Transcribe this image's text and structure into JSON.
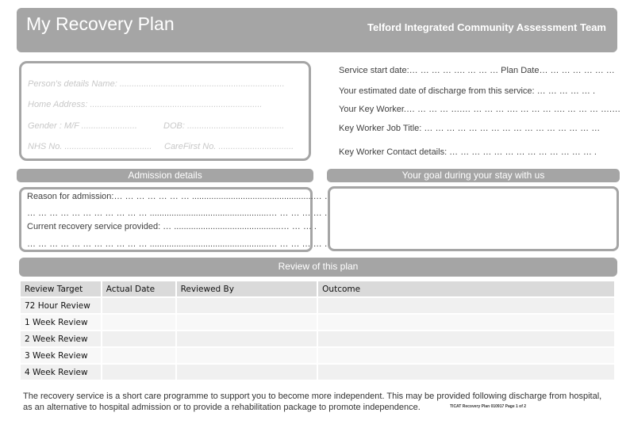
{
  "header": {
    "title": "My Recovery Plan",
    "organisation": "Telford Integrated Community Assessment Team"
  },
  "person_details": {
    "name_line": "Person's details   Name: ....................................................................",
    "address_line": "Home Address: .......................................................................",
    "gender_line": "Gender : M/F .......................",
    "dob_line": "DOB: ........................................",
    "nhs_line": "NHS No. ....................................",
    "carefirst_line": "CareFirst No. ..............................."
  },
  "service_info": {
    "start_date": "Service start date:… … … … …. … … …  Plan Date… … … … … … …",
    "discharge": "Your estimated date of discharge from this service: … … … … … .",
    "key_worker": "Your Key Worker.… … … … ….… … … … …. … … … …. … … … ….…",
    "job_title": "Key Worker Job Title: … … … … … … … … … … … … … … … …",
    "contact": "Key Worker Contact details: … … … … … … … … … … … … … ."
  },
  "admission": {
    "heading": "Admission details",
    "reason": "Reason for admission:… … … … … … … ..................................................… … …",
    "reason_cont": "… … … … … … … … … … … .................................................… … … … … …",
    "service": "Current recovery service provided: … ............................................… … … .",
    "service_cont": "… … … … … … … … … … … .................................................… … … … … …"
  },
  "goal": {
    "heading": "Your goal during your stay with us",
    "value": ""
  },
  "review": {
    "heading": "Review of this plan",
    "columns": [
      "Review Target",
      "Actual Date",
      "Reviewed By",
      "Outcome"
    ],
    "rows": [
      [
        "72 Hour Review",
        "",
        "",
        ""
      ],
      [
        "1 Week Review",
        "",
        "",
        ""
      ],
      [
        "2 Week Review",
        "",
        "",
        ""
      ],
      [
        "3 Week Review",
        "",
        "",
        ""
      ],
      [
        "4 Week Review",
        "",
        "",
        ""
      ]
    ]
  },
  "footer": {
    "line1": "The recovery service is a short care programme to support you to become more independent.  This may be provided following discharge from hospital,",
    "line2": "as an alternative to hospital admission or to provide a rehabilitation package to promote independence.",
    "reference": "TICAT Recovery Plan 010917    Page 1 of 2"
  }
}
